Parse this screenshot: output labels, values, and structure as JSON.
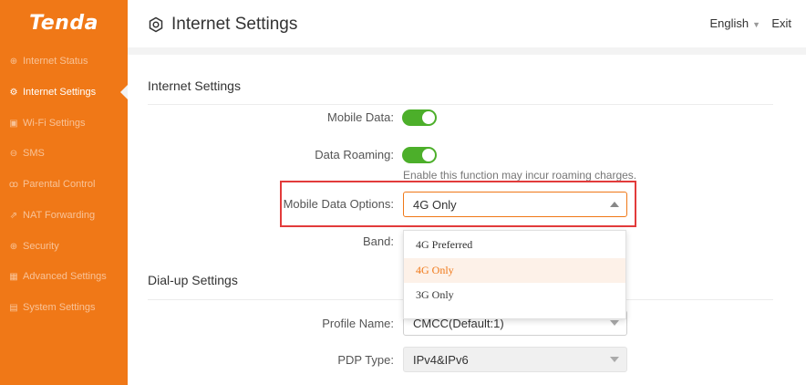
{
  "brand": {
    "logo": "Tenda"
  },
  "sidebar": {
    "items": [
      {
        "label": "Internet Status",
        "icon": "globe-icon",
        "glyph": "⊕",
        "active": false
      },
      {
        "label": "Internet Settings",
        "icon": "settings-gear-icon",
        "glyph": "⚙",
        "active": true
      },
      {
        "label": "Wi-Fi Settings",
        "icon": "wifi-icon",
        "glyph": "▣",
        "active": false
      },
      {
        "label": "SMS",
        "icon": "sms-icon",
        "glyph": "⊖",
        "active": false
      },
      {
        "label": "Parental Control",
        "icon": "parental-control-icon",
        "glyph": "ꝏ",
        "active": false
      },
      {
        "label": "NAT Forwarding",
        "icon": "nat-forwarding-icon",
        "glyph": "⇗",
        "active": false
      },
      {
        "label": "Security",
        "icon": "security-icon",
        "glyph": "⊕",
        "active": false
      },
      {
        "label": "Advanced Settings",
        "icon": "advanced-settings-icon",
        "glyph": "▦",
        "active": false
      },
      {
        "label": "System Settings",
        "icon": "system-settings-icon",
        "glyph": "▤",
        "active": false
      }
    ]
  },
  "header": {
    "title": "Internet Settings",
    "language": "English",
    "exit": "Exit"
  },
  "internet": {
    "section_title": "Internet Settings",
    "mobile_data": {
      "label": "Mobile Data:",
      "enabled": true
    },
    "data_roaming": {
      "label": "Data Roaming:",
      "enabled": true,
      "hint": "Enable this function may incur roaming charges."
    },
    "mobile_data_options": {
      "label": "Mobile Data Options:",
      "value": "4G Only",
      "options": [
        "4G Preferred",
        "4G Only",
        "3G Only"
      ]
    },
    "band": {
      "label": "Band:"
    }
  },
  "dialup": {
    "section_title": "Dial-up Settings",
    "profile_name": {
      "label": "Profile Name:",
      "value": "CMCC(Default:1)"
    },
    "pdp_type": {
      "label": "PDP Type:",
      "value": "IPv4&IPv6"
    }
  },
  "colors": {
    "accent": "#f07817",
    "toggle_on": "#4caf2a",
    "highlight": "#e23b3b"
  }
}
